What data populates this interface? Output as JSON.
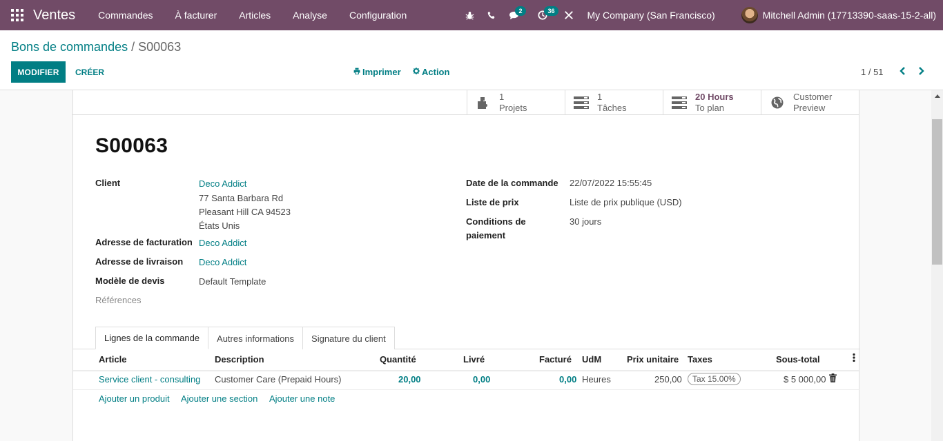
{
  "navbar": {
    "app_name": "Ventes",
    "menu": [
      "Commandes",
      "À facturer",
      "Articles",
      "Analyse",
      "Configuration"
    ],
    "messages_badge": "2",
    "activities_badge": "36",
    "company": "My Company (San Francisco)",
    "user": "Mitchell Admin (17713390-saas-15-2-all)"
  },
  "breadcrumb": {
    "parent": "Bons de commandes",
    "separator": "/",
    "current": "S00063"
  },
  "actions": {
    "edit": "MODIFIER",
    "create": "CRÉER",
    "print": "Imprimer",
    "action": "Action"
  },
  "pager": {
    "value": "1 / 51"
  },
  "smart_buttons": [
    {
      "count": "1",
      "label": "Projets",
      "icon": "puzzle-icon"
    },
    {
      "count": "1",
      "label": "Tâches",
      "icon": "tasks-icon"
    },
    {
      "count": "20 Hours",
      "label": "To plan",
      "icon": "tasks-icon"
    },
    {
      "count": "Customer",
      "label": "Preview",
      "icon": "globe-icon"
    }
  ],
  "record": {
    "name": "S00063",
    "labels": {
      "client": "Client",
      "invoice_address": "Adresse de facturation",
      "delivery_address": "Adresse de livraison",
      "quote_template": "Modèle de devis",
      "references": "Références",
      "order_date": "Date de la commande",
      "pricelist": "Liste de prix",
      "payment_terms_1": "Conditions de",
      "payment_terms_2": "paiement"
    },
    "client": "Deco Addict",
    "address_line1": "77 Santa Barbara Rd",
    "address_line2": "Pleasant Hill CA 94523",
    "address_line3": "États Unis",
    "invoice_address": "Deco Addict",
    "delivery_address": "Deco Addict",
    "quote_template": "Default Template",
    "order_date": "22/07/2022 15:55:45",
    "pricelist": "Liste de prix publique (USD)",
    "payment_terms": "30 jours"
  },
  "tabs": [
    "Lignes de la commande",
    "Autres informations",
    "Signature du client"
  ],
  "table": {
    "headers": {
      "article": "Article",
      "description": "Description",
      "quantity": "Quantité",
      "delivered": "Livré",
      "invoiced": "Facturé",
      "uom": "UdM",
      "unit_price": "Prix unitaire",
      "taxes": "Taxes",
      "subtotal": "Sous-total"
    },
    "rows": [
      {
        "article": "Service client - consulting",
        "description": "Customer Care (Prepaid Hours)",
        "quantity": "20,00",
        "delivered": "0,00",
        "invoiced": "0,00",
        "uom": "Heures",
        "unit_price": "250,00",
        "tax": "Tax 15.00%",
        "subtotal": "$ 5 000,00"
      }
    ],
    "add_product": "Ajouter un produit",
    "add_section": "Ajouter une section",
    "add_note": "Ajouter une note"
  }
}
